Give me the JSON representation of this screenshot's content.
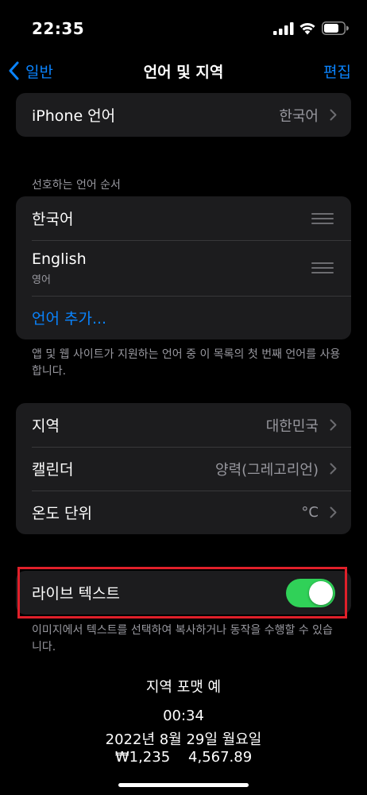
{
  "status": {
    "time": "22:35"
  },
  "nav": {
    "back_label": "일반",
    "title": "언어 및 지역",
    "edit_label": "편집"
  },
  "iphone_language": {
    "label": "iPhone 언어",
    "value": "한국어"
  },
  "preferred": {
    "header": "선호하는 언어 순서",
    "languages": [
      {
        "name": "한국어",
        "sub": ""
      },
      {
        "name": "English",
        "sub": "영어"
      }
    ],
    "add_label": "언어 추가...",
    "footnote": "앱 및 웹 사이트가 지원하는 언어 중 이 목록의 첫 번째 언어를 사용합니다."
  },
  "region_group": {
    "rows": [
      {
        "label": "지역",
        "value": "대한민국"
      },
      {
        "label": "캘린더",
        "value": "양력(그레고리언)"
      },
      {
        "label": "온도 단위",
        "value": "°C"
      }
    ]
  },
  "live_text": {
    "label": "라이브 텍스트",
    "enabled": true,
    "toggle_color": "#30d158",
    "footnote": "이미지에서 텍스트를 선택하여 복사하거나 동작을 수행할 수 있습니다."
  },
  "format_example": {
    "title": "지역 포맷 예",
    "time": "00:34",
    "date": "2022년 8월 29일 월요일",
    "numbers": "₩1,235    4,567.89"
  },
  "colors": {
    "accent": "#0a84ff",
    "highlight": "#e0202a"
  }
}
